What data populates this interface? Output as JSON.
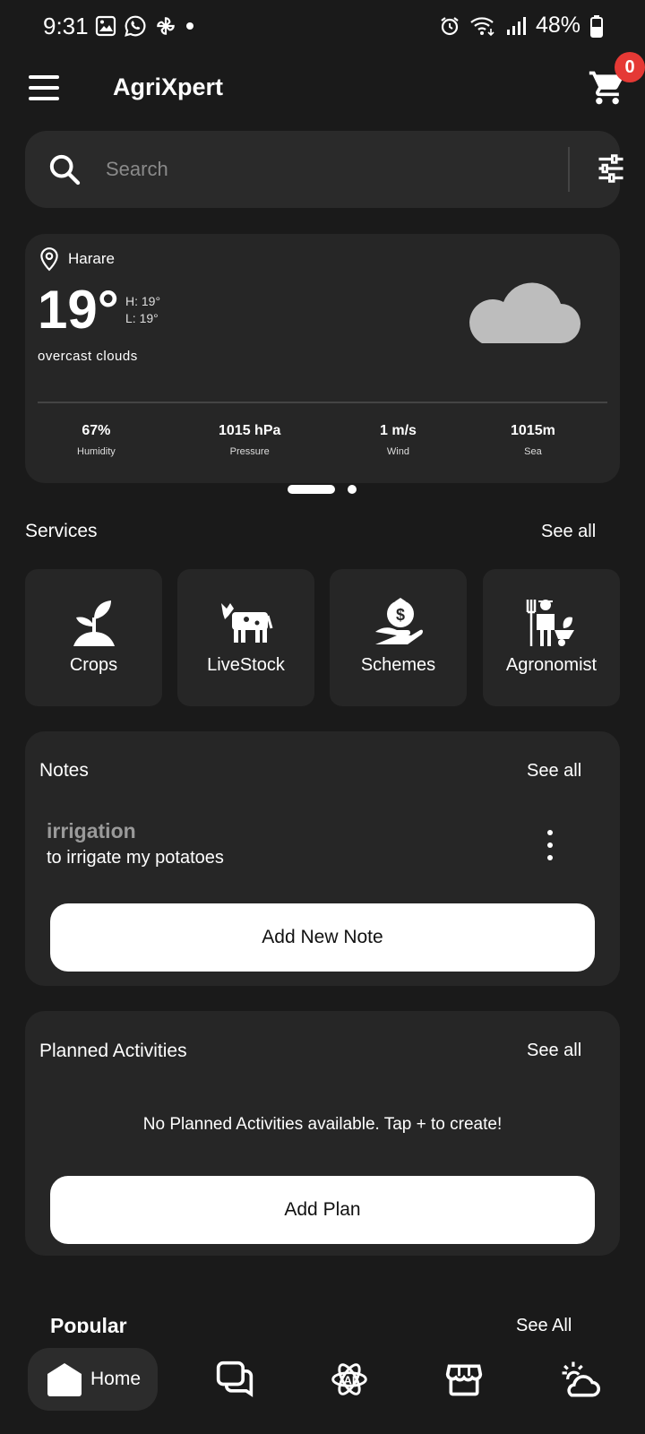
{
  "status_bar": {
    "time": "9:31",
    "battery": "48%"
  },
  "app": {
    "title": "AgriXpert",
    "cart_count": "0"
  },
  "search": {
    "placeholder": "Search"
  },
  "weather": {
    "location": "Harare",
    "temp": "19°",
    "high": "H: 19°",
    "low": "L: 19°",
    "description": "overcast clouds",
    "stats": [
      {
        "value": "67%",
        "label": "Humidity"
      },
      {
        "value": "1015 hPa",
        "label": "Pressure"
      },
      {
        "value": "1 m/s",
        "label": "Wind"
      },
      {
        "value": "1015m",
        "label": "Sea"
      }
    ]
  },
  "services": {
    "title": "Services",
    "see_all": "See all",
    "items": [
      {
        "label": "Crops",
        "icon": "plant-icon"
      },
      {
        "label": "LiveStock",
        "icon": "cow-icon"
      },
      {
        "label": "Schemes",
        "icon": "money-hand-icon"
      },
      {
        "label": "Agronomist",
        "icon": "farmer-icon"
      }
    ]
  },
  "notes": {
    "title": "Notes",
    "see_all": "See all",
    "item": {
      "title": "irrigation",
      "body": "to irrigate my potatoes"
    },
    "add_label": "Add New Note"
  },
  "planned": {
    "title": "Planned Activities",
    "see_all": "See all",
    "empty": "No Planned Activities available. Tap + to create!",
    "add_label": "Add Plan"
  },
  "popular": {
    "title": "Popular",
    "see_all": "See All"
  },
  "nav": {
    "home_label": "Home"
  }
}
